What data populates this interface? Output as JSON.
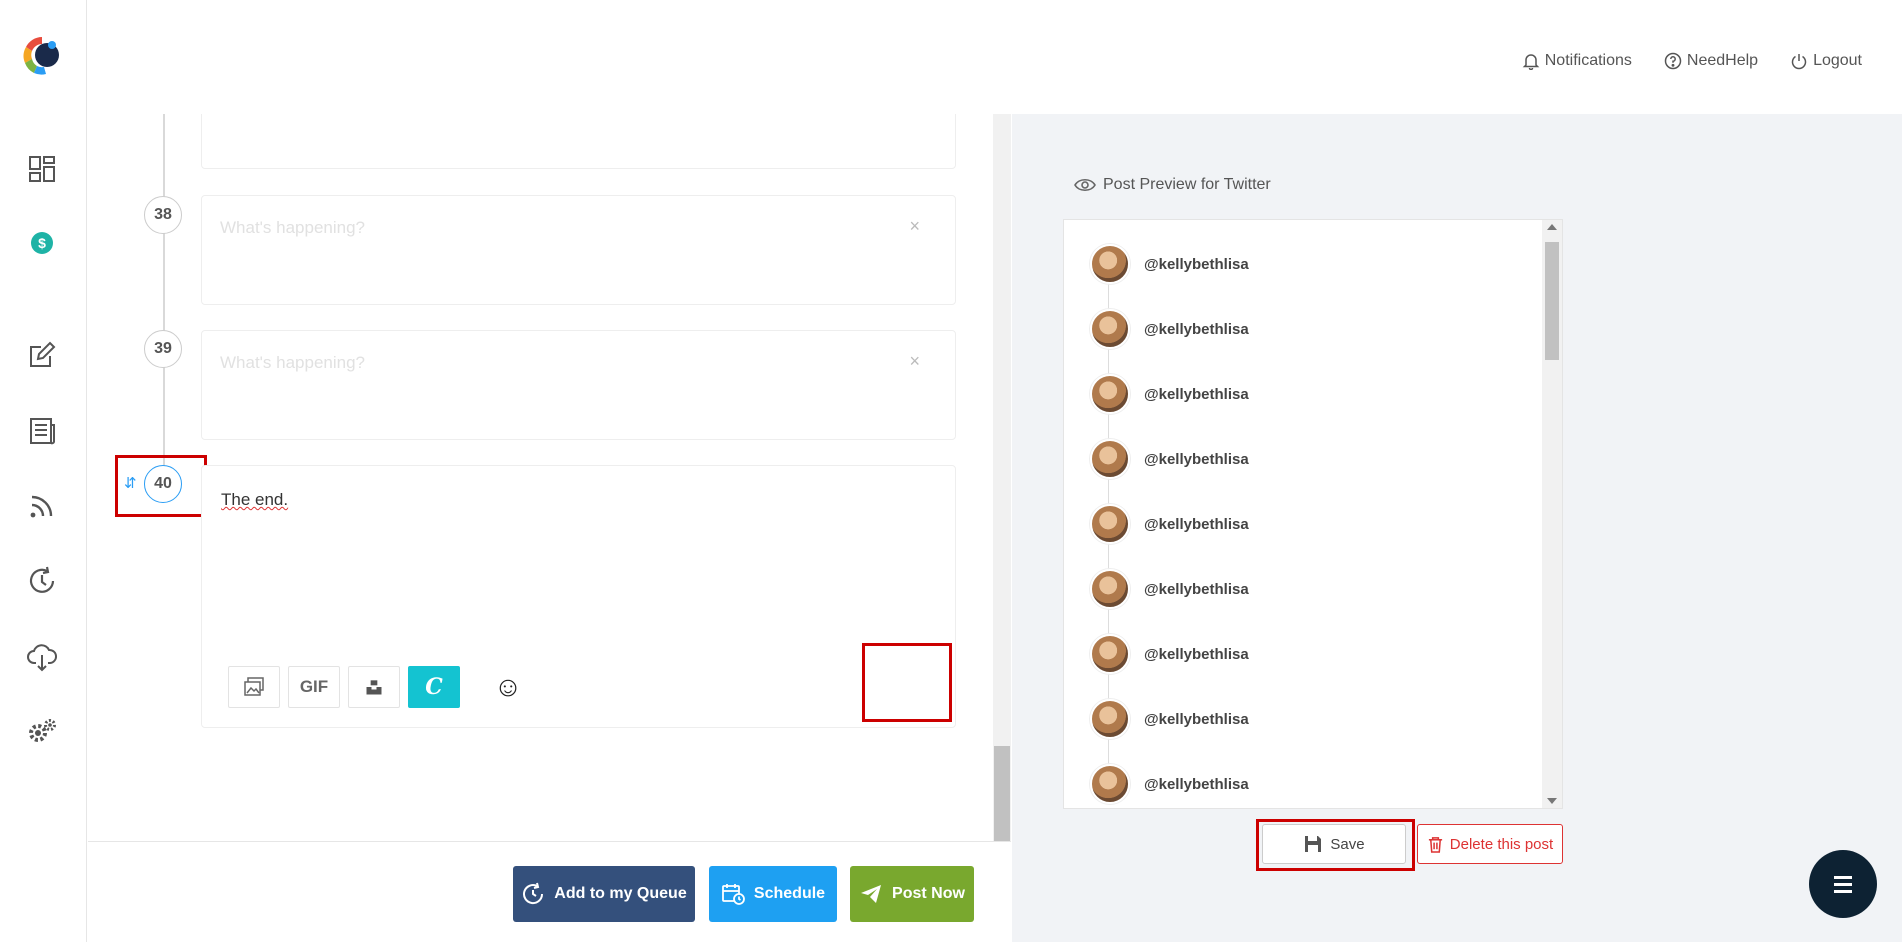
{
  "app": {
    "brand_colors": {
      "accent": "#2a9df4",
      "queue": "#34507c",
      "schedule": "#1ea0f2",
      "post_now": "#79a82e",
      "danger": "#dd3333",
      "highlight": "#cc0000"
    }
  },
  "sidebar": {
    "items": [
      {
        "icon": "dashboard-icon"
      },
      {
        "icon": "dollar-icon"
      },
      {
        "icon": "compose-icon"
      },
      {
        "icon": "article-icon"
      },
      {
        "icon": "rss-icon"
      },
      {
        "icon": "recycle-clock-icon"
      },
      {
        "icon": "cloud-download-icon"
      },
      {
        "icon": "settings-gears-icon"
      }
    ]
  },
  "header": {
    "notifications": "Notifications",
    "help": "NeedHelp",
    "logout": "Logout"
  },
  "thread": {
    "items": [
      {
        "number": "38",
        "placeholder": "What's happening?",
        "close": "×"
      },
      {
        "number": "39",
        "placeholder": "What's happening?",
        "close": "×"
      },
      {
        "number": "40",
        "text": "The end."
      }
    ],
    "tools": {
      "gif": "GIF",
      "canva": "C",
      "emoji": "☺"
    },
    "add": "+"
  },
  "actions": {
    "queue": "Add to my Queue",
    "schedule": "Schedule",
    "post_now": "Post Now"
  },
  "preview": {
    "title": "Post Preview for Twitter",
    "handles": [
      "@kellybethlisa",
      "@kellybethlisa",
      "@kellybethlisa",
      "@kellybethlisa",
      "@kellybethlisa",
      "@kellybethlisa",
      "@kellybethlisa",
      "@kellybethlisa",
      "@kellybethlisa"
    ],
    "save": "Save",
    "delete": "Delete this post"
  }
}
